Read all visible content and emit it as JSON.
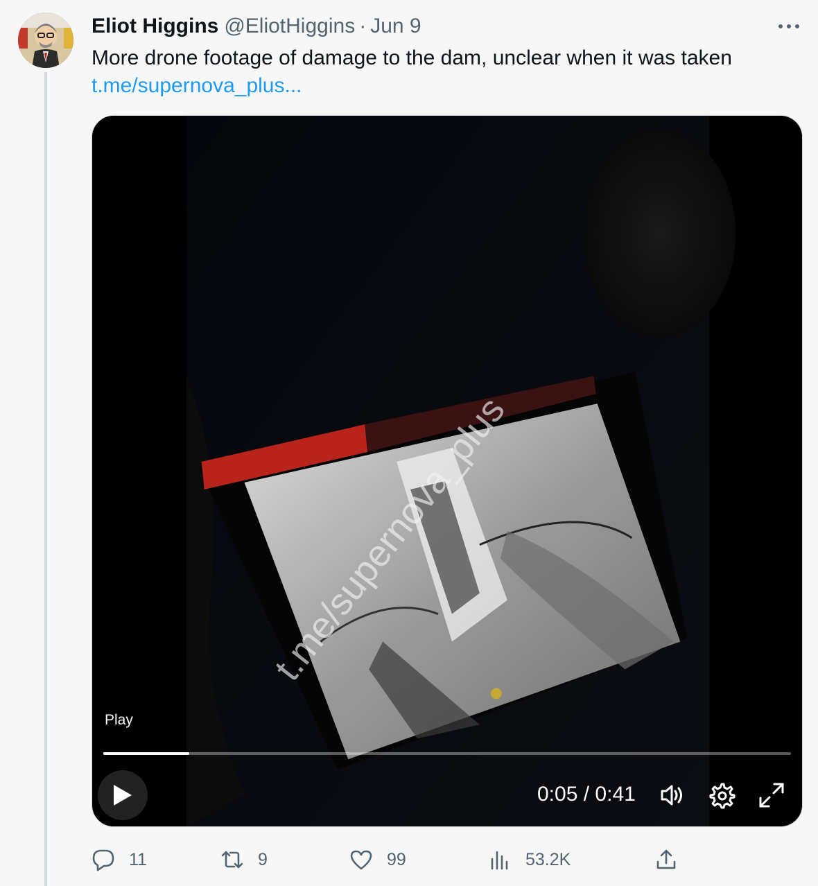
{
  "tweet": {
    "author_name": "Eliot Higgins",
    "author_handle": "@EliotHiggins",
    "separator": "·",
    "date": "Jun 9",
    "more_label": "•••",
    "text": "More drone footage of damage to the dam, unclear when it was taken",
    "link_text": "t.me/supernova_plus..."
  },
  "video": {
    "play_label": "Play",
    "current_time": "0:05",
    "time_separator": "/",
    "duration": "0:41",
    "progress_fraction": 0.125,
    "watermark": "t.me/supernova_plus"
  },
  "actions": {
    "replies": "11",
    "retweets": "9",
    "likes": "99",
    "views": "53.2K"
  },
  "colors": {
    "link": "#1d9bf0",
    "secondary_text": "#536471",
    "thread_line": "#cfd9de"
  }
}
